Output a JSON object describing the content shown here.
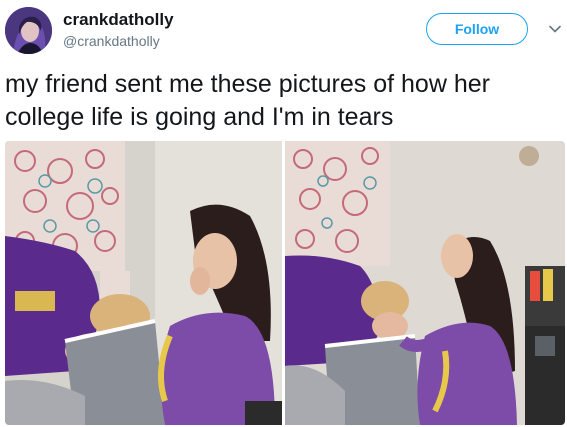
{
  "user": {
    "display_name": "crankdatholly",
    "handle": "@crankdatholly",
    "avatar_icon": "profile-avatar"
  },
  "actions": {
    "follow_label": "Follow",
    "menu_icon": "chevron-down-icon"
  },
  "tweet": {
    "text": "my friend sent me these pictures of how her college life is going and I'm in tears"
  },
  "media": {
    "photo_count": 2
  },
  "colors": {
    "accent": "#1da1f2",
    "text": "#14171a",
    "secondary": "#657786",
    "purple_shirt": "#5a2a8c"
  }
}
